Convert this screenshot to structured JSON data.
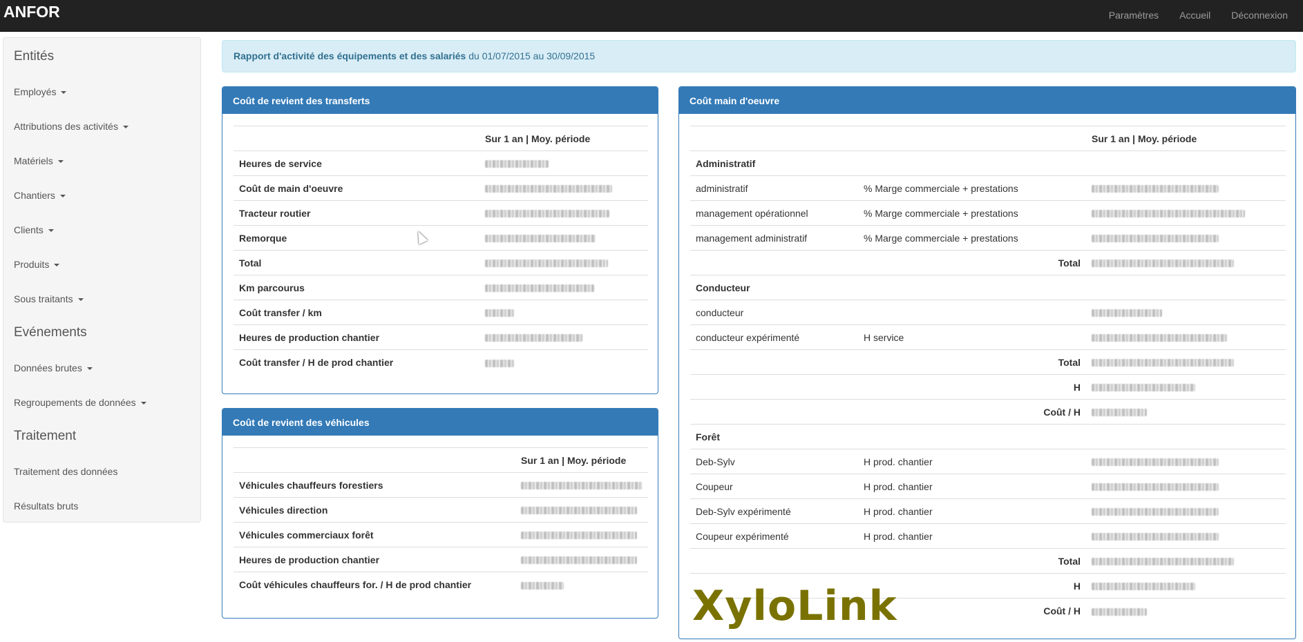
{
  "navbar": {
    "brand": "ANFOR",
    "links": [
      "Paramètres",
      "Accueil",
      "Déconnexion"
    ]
  },
  "sidebar": {
    "sections": [
      {
        "heading": "Entités",
        "items": [
          "Employés",
          "Attributions des activités",
          "Matériels",
          "Chantiers",
          "Clients",
          "Produits",
          "Sous traitants"
        ]
      },
      {
        "heading": "Evénements",
        "items": [
          "Données brutes",
          "Regroupements de données"
        ]
      },
      {
        "heading": "Traitement",
        "items": [
          "Traitement des données",
          "Résultats bruts"
        ]
      }
    ]
  },
  "report": {
    "title": "Rapport d'activité des équipements et des salariés",
    "period": "du 01/07/2015 au 30/09/2015"
  },
  "transferts": {
    "title": "Coût de revient des transferts",
    "col_header": "Sur 1 an | Moy. période",
    "rows": [
      "Heures de service",
      "Coût de main d'oeuvre",
      "Tracteur routier",
      "Remorque",
      "Total",
      "Km parcourus",
      "Coût transfer / km",
      "Heures de production chantier",
      "Coût transfer / H de prod chantier"
    ]
  },
  "vehicules": {
    "title": "Coût de revient des véhicules",
    "col_header": "Sur 1 an | Moy. période",
    "rows": [
      "Véhicules chauffeurs forestiers",
      "Véhicules direction",
      "Véhicules commerciaux forêt",
      "Heures de production chantier",
      "Coût véhicules chauffeurs for. / H de prod chantier"
    ]
  },
  "main_oeuvre": {
    "title": "Coût main d'oeuvre",
    "col_header": "Sur 1 an | Moy. période",
    "groups": {
      "admin": {
        "name": "Administratif",
        "rows": [
          {
            "label": "administratif",
            "basis": "% Marge commerciale + prestations"
          },
          {
            "label": "management opérationnel",
            "basis": "% Marge commerciale + prestations"
          },
          {
            "label": "management administratif",
            "basis": "% Marge commerciale + prestations"
          }
        ],
        "total_label": "Total"
      },
      "conducteur": {
        "name": "Conducteur",
        "rows": [
          {
            "label": "conducteur",
            "basis": ""
          },
          {
            "label": "conducteur expérimenté",
            "basis": "H service"
          }
        ],
        "total_label": "Total",
        "h_label": "H",
        "cout_label": "Coût / H"
      },
      "foret": {
        "name": "Forêt",
        "rows": [
          {
            "label": "Deb-Sylv",
            "basis": "H prod. chantier"
          },
          {
            "label": "Coupeur",
            "basis": "H prod. chantier"
          },
          {
            "label": "Deb-Sylv expérimenté",
            "basis": "H prod. chantier"
          },
          {
            "label": "Coupeur expérimenté",
            "basis": "H prod. chantier"
          }
        ],
        "total_label": "Total",
        "h_label": "H",
        "cout_label": "Coût / H"
      }
    }
  },
  "logo": "XyloLink"
}
